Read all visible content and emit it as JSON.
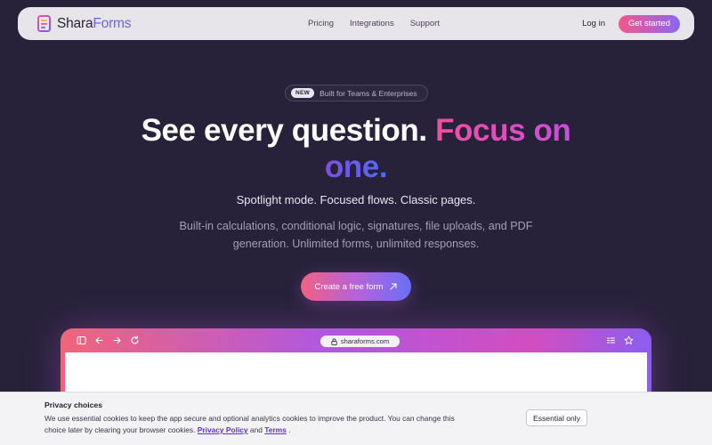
{
  "nav": {
    "logo_part1": "Shara",
    "logo_part2": "Forms",
    "links": [
      "Pricing",
      "Integrations",
      "Support"
    ],
    "login": "Log in",
    "get_started": "Get started"
  },
  "hero": {
    "badge_new": "NEW",
    "badge_text": "Built for Teams & Enterprises",
    "headline_plain": "See every question.",
    "headline_accent1": "Focus on",
    "headline_accent2": "one.",
    "subhead": "Spotlight mode. Focused flows. Classic pages.",
    "description": "Built-in calculations, conditional logic, signatures, file uploads, and PDF generation. Unlimited forms, unlimited responses.",
    "cta": "Create a free form"
  },
  "browser": {
    "url": "sharaforms.com",
    "left_icons": [
      "sidebar-icon",
      "back-arrow-icon",
      "forward-arrow-icon",
      "refresh-icon"
    ],
    "right_icons": [
      "tabs-icon",
      "star-icon"
    ]
  },
  "cookie": {
    "title": "Privacy choices",
    "text_before": "We use essential cookies to keep the app secure and optional analytics cookies to improve the product. You can change this choice later by clearing your browser cookies.",
    "privacy_link": "Privacy Policy",
    "and": "and",
    "terms_link": "Terms",
    "period": ".",
    "essential_button": "Essential only"
  },
  "colors": {
    "background": "#27223a",
    "nav_bg": "#e8e5ea",
    "accent_pink": "#f24fa0",
    "accent_blue": "#4f6cf0",
    "link": "#5a33d6"
  }
}
